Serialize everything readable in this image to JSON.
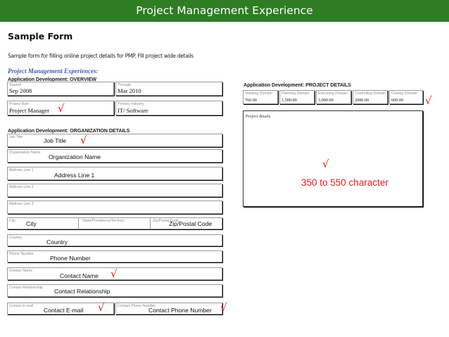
{
  "header": {
    "title": "Project Management  Experience"
  },
  "page": {
    "title": "Sample Form",
    "description": "Sample form for filling online project details for PMP. Fill project wide details",
    "subtitle": "Project Management Experiences:"
  },
  "overview": {
    "heading": "Application Development: OVERVIEW",
    "started_label": "Started",
    "started_value": "Sep 2008",
    "through_label": "Through",
    "through_value": "Mar 2010",
    "role_label": "Project Role",
    "role_value": "Project Manager",
    "industry_label": "Primary Industry",
    "industry_value": "IT/ Software"
  },
  "org": {
    "heading": "Application Development: ORGANIZATION DETAILS",
    "job_title_label": "Job Title",
    "job_title_value": "Job Title",
    "org_name_label": "Organization Name",
    "org_name_value": "Organization Name",
    "addr1_label": "Address Line 1",
    "addr1_value": "Address Line 1",
    "addr2_label": "Address Line 2",
    "addr3_label": "Address Line 3",
    "city_label": "City",
    "city_value": "City",
    "state_label": "State/Providence/Territory",
    "zip_label": "Zip/Postal Code",
    "zip_value": "Zip/Postal Code",
    "country_label": "Country",
    "country_value": "Country",
    "phone_label": "Phone Number",
    "phone_value": "Phone Number",
    "contact_name_label": "Contact Name",
    "contact_name_value": "Contact Name",
    "contact_rel_label": "Contact Relationship",
    "contact_rel_value": "Contact Relationship",
    "contact_email_label": "Contact E-mail",
    "contact_email_value": "Contact E-mail",
    "contact_phone_label": "Contact Phone Number",
    "contact_phone_value": "Contact Phone Number"
  },
  "project": {
    "heading": "Application Development: PROJECT DETAILS",
    "domains": [
      {
        "label": "Initiating Domain",
        "value": "760.00"
      },
      {
        "label": "Planning Domain",
        "value": "1,500.00"
      },
      {
        "label": "Executing Domain",
        "value": "3,000.00"
      },
      {
        "label": "Controlling Domain",
        "value": "2000.00"
      },
      {
        "label": "Closing Domain",
        "value": "600.00"
      }
    ],
    "details_label": "Project details",
    "details_note": "350 to 550 character"
  },
  "marks": {
    "check": "√"
  },
  "colors": {
    "header_bg": "#2e7d23",
    "check": "#e0201c",
    "subtitle": "#3c5fa8"
  }
}
